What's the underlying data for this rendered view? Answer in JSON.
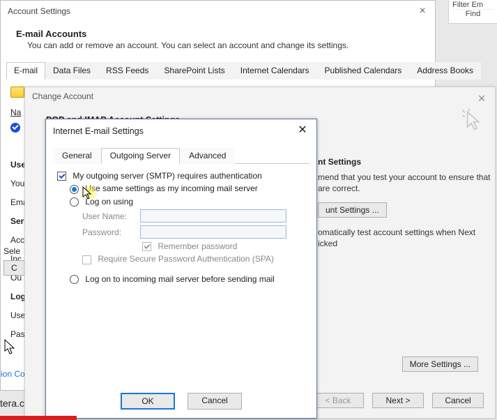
{
  "ribbon": {
    "filter": "Filter Em",
    "find": "Find"
  },
  "acct": {
    "title": "Account Settings",
    "heading": "E-mail Accounts",
    "desc": "You can add or remove an account. You can select an account and change its settings.",
    "tabs": [
      "E-mail",
      "Data Files",
      "RSS Feeds",
      "SharePoint Lists",
      "Internet Calendars",
      "Published Calendars",
      "Address Books"
    ],
    "col_name": "Na",
    "left": {
      "use": "Use",
      "you": "You",
      "ema": "Ema",
      "ser": "Ser",
      "acc": "Acc",
      "inc": "Inc",
      "out": "Ou",
      "log": "Log",
      "use2": "Use",
      "pas": "Pas"
    },
    "sele": "Sele",
    "cbtn": "C",
    "ion": "ion Co",
    "tera": "tera.c"
  },
  "change": {
    "title": "Change Account",
    "heading": "POP and IMAP Account Settings",
    "test": {
      "heading": "nt Settings",
      "line1": "mend that you test your account to ensure that are correct.",
      "btn": "unt Settings ...",
      "line2": "omatically test account settings when Next icked"
    },
    "more": "More Settings ...",
    "back": "< Back",
    "next": "Next >",
    "cancel": "Cancel"
  },
  "ies": {
    "title": "Internet E-mail Settings",
    "tabs": {
      "general": "General",
      "outgoing": "Outgoing Server",
      "advanced": "Advanced"
    },
    "requires_auth": "My outgoing server (SMTP) requires authentication",
    "use_same": "Use same settings as my incoming mail server",
    "log_on_using": "Log on using",
    "user_name": "User Name:",
    "password": "Password:",
    "remember": "Remember password",
    "spa": "Require Secure Password Authentication (SPA)",
    "logon_before": "Log on to incoming mail server before sending mail",
    "ok": "OK",
    "cancel": "Cancel"
  }
}
